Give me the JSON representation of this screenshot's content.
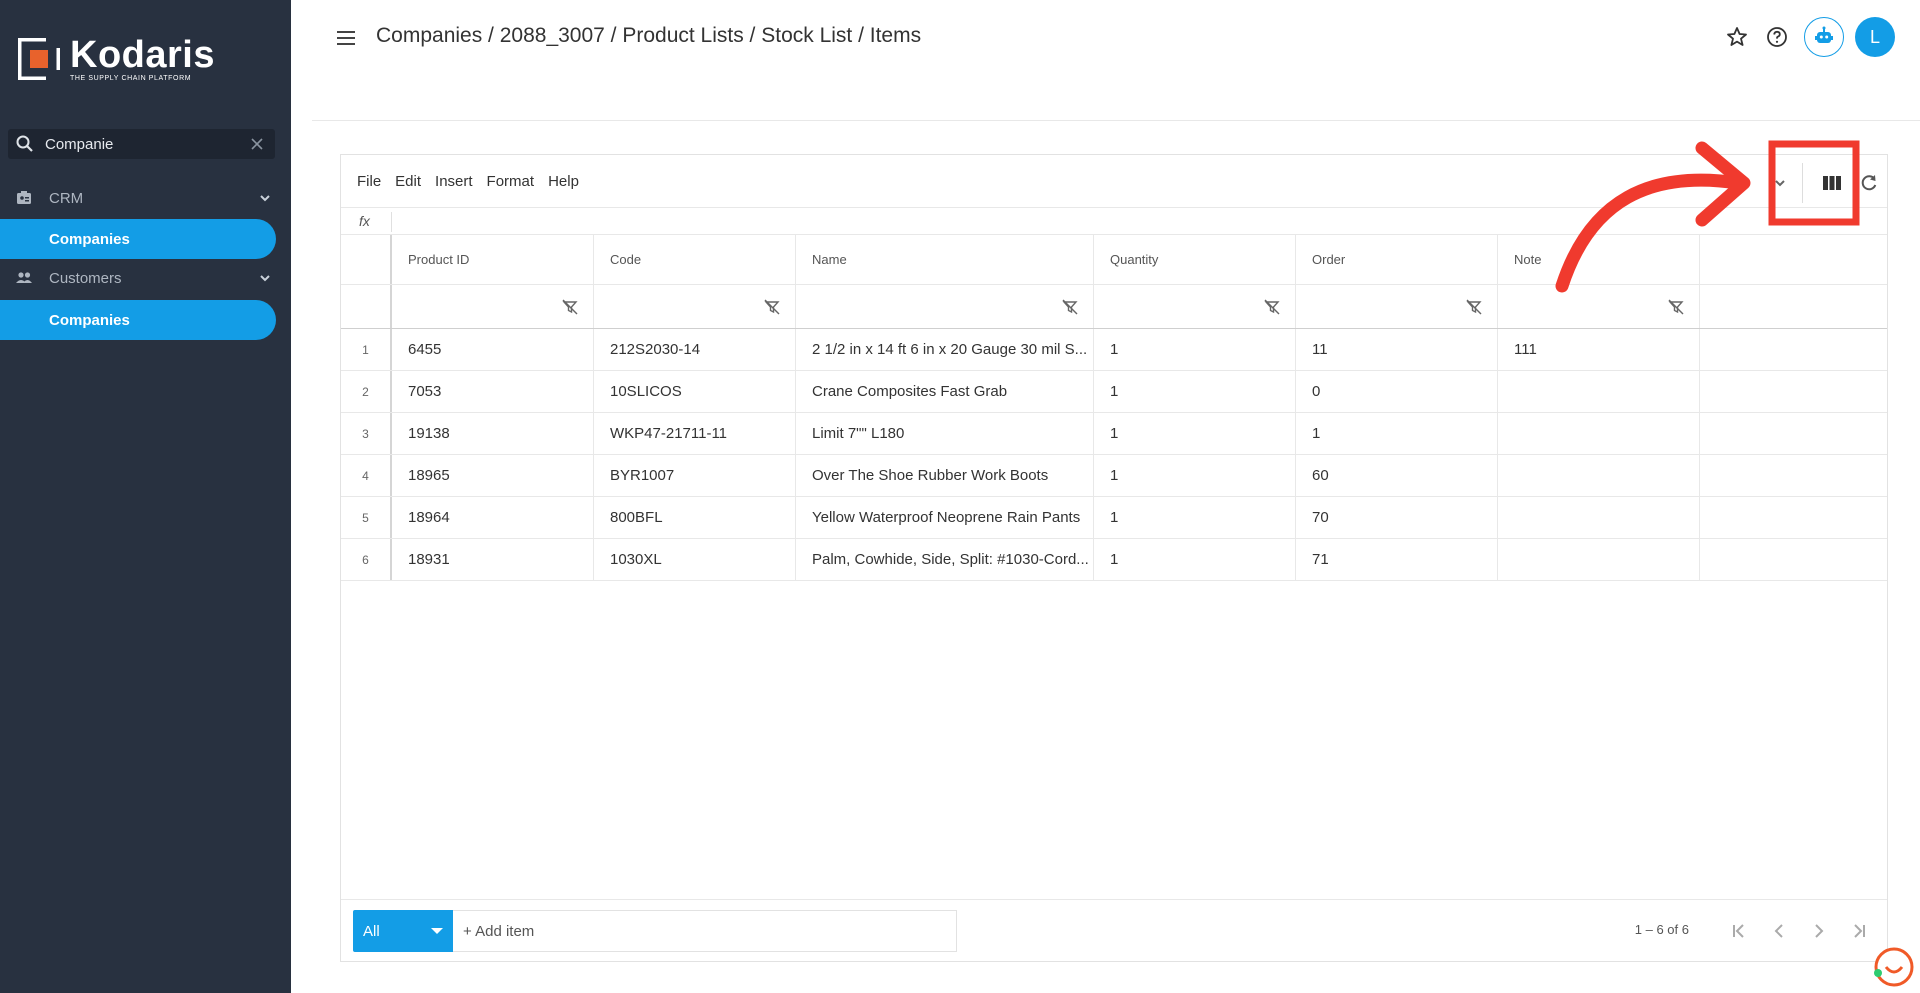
{
  "app": {
    "logo_text": "Kodaris",
    "logo_tagline": "THE SUPPLY CHAIN PLATFORM"
  },
  "sidebar": {
    "search_value": "Companie",
    "groups": [
      {
        "label": "CRM",
        "icon": "badge-icon",
        "item": "Companies"
      },
      {
        "label": "Customers",
        "icon": "people-icon",
        "item": "Companies"
      }
    ]
  },
  "header": {
    "breadcrumb": "Companies / 2088_3007 / Product Lists / Stock List / Items",
    "avatar_initial": "L"
  },
  "editor": {
    "menu": [
      "File",
      "Edit",
      "Insert",
      "Format",
      "Help"
    ],
    "fx_label": "fx"
  },
  "table": {
    "columns": [
      "Product ID",
      "Code",
      "Name",
      "Quantity",
      "Order",
      "Note"
    ],
    "rows": [
      {
        "n": "1",
        "product_id": "6455",
        "code": "212S2030-14",
        "name": "2 1/2 in x 14 ft 6 in x 20 Gauge 30 mil S...",
        "quantity": "1",
        "order": "11",
        "note": "111"
      },
      {
        "n": "2",
        "product_id": "7053",
        "code": "10SLICOS",
        "name": "Crane Composites Fast Grab",
        "quantity": "1",
        "order": "0",
        "note": ""
      },
      {
        "n": "3",
        "product_id": "19138",
        "code": "WKP47-21711-11",
        "name": "Limit 7\"\" L180",
        "quantity": "1",
        "order": "1",
        "note": ""
      },
      {
        "n": "4",
        "product_id": "18965",
        "code": "BYR1007",
        "name": "Over The Shoe Rubber Work Boots",
        "quantity": "1",
        "order": "60",
        "note": ""
      },
      {
        "n": "5",
        "product_id": "18964",
        "code": "800BFL",
        "name": "Yellow Waterproof Neoprene Rain Pants",
        "quantity": "1",
        "order": "70",
        "note": ""
      },
      {
        "n": "6",
        "product_id": "18931",
        "code": "1030XL",
        "name": "Palm, Cowhide, Side, Split: #1030-Cord...",
        "quantity": "1",
        "order": "71",
        "note": ""
      }
    ]
  },
  "footer": {
    "filter_value": "All",
    "add_item_label": "+ Add item",
    "pager_text": "1 – 6 of 6"
  },
  "colors": {
    "accent": "#139de6",
    "sidebar_bg": "#283140",
    "annotation": "#f03a2e"
  }
}
